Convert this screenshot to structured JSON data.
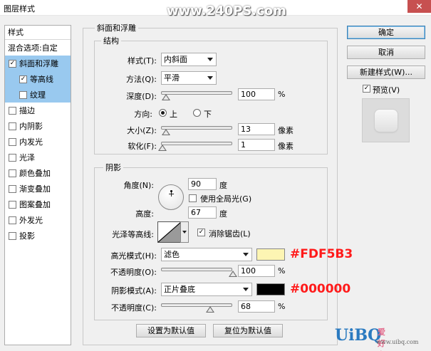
{
  "window": {
    "title": "图层样式",
    "close_glyph": "✕"
  },
  "watermark": "www.240PS.com",
  "style_list": {
    "header": "样式",
    "blend_options": "混合选项:自定",
    "items": [
      {
        "label": "斜面和浮雕",
        "checked": true,
        "selected": true
      },
      {
        "label": "等高线",
        "checked": true,
        "sub": true
      },
      {
        "label": "纹理",
        "checked": false,
        "sub": true
      },
      {
        "label": "描边",
        "checked": false
      },
      {
        "label": "内阴影",
        "checked": false
      },
      {
        "label": "内发光",
        "checked": false
      },
      {
        "label": "光泽",
        "checked": false
      },
      {
        "label": "颜色叠加",
        "checked": false
      },
      {
        "label": "渐变叠加",
        "checked": false
      },
      {
        "label": "图案叠加",
        "checked": false
      },
      {
        "label": "外发光",
        "checked": false
      },
      {
        "label": "投影",
        "checked": false
      }
    ]
  },
  "bevel": {
    "legend": "斜面和浮雕",
    "structure": {
      "legend": "结构",
      "style_label": "样式(T):",
      "style_value": "内斜面",
      "technique_label": "方法(Q):",
      "technique_value": "平滑",
      "depth_label": "深度(D):",
      "depth_value": "100",
      "depth_unit": "%",
      "direction_label": "方向:",
      "dir_up": "上",
      "dir_down": "下",
      "size_label": "大小(Z):",
      "size_value": "13",
      "size_unit": "像素",
      "soften_label": "软化(F):",
      "soften_value": "1",
      "soften_unit": "像素"
    },
    "shading": {
      "legend": "阴影",
      "angle_label": "角度(N):",
      "angle_value": "90",
      "angle_unit": "度",
      "global_light": "使用全局光(G)",
      "altitude_label": "高度:",
      "altitude_value": "67",
      "altitude_unit": "度",
      "gloss_contour_label": "光泽等高线:",
      "anti_alias": "消除锯齿(L)",
      "highlight_mode_label": "高光模式(H):",
      "highlight_mode_value": "滤色",
      "highlight_color": "#FDF5B3",
      "highlight_opacity_label": "不透明度(O):",
      "highlight_opacity_value": "100",
      "shadow_mode_label": "阴影模式(A):",
      "shadow_mode_value": "正片叠底",
      "shadow_color": "#000000",
      "shadow_opacity_label": "不透明度(C):",
      "shadow_opacity_value": "68",
      "percent": "%"
    },
    "make_default": "设置为默认值",
    "reset_default": "复位为默认值"
  },
  "levels": {
    "depth": 0.06,
    "size": 0.06,
    "soften": 0.01,
    "highlight_opacity": 1.0,
    "shadow_opacity": 0.68
  },
  "buttons": {
    "ok": "确定",
    "cancel": "取消",
    "new_style": "新建样式(W)...",
    "preview": "预览(V)"
  },
  "annotations": {
    "highlight": "#FDF5B3",
    "shadow": "#000000"
  },
  "site_logo": {
    "main": "UiBQ",
    "cn": "爱好者",
    "url": "www.uibq.com"
  }
}
